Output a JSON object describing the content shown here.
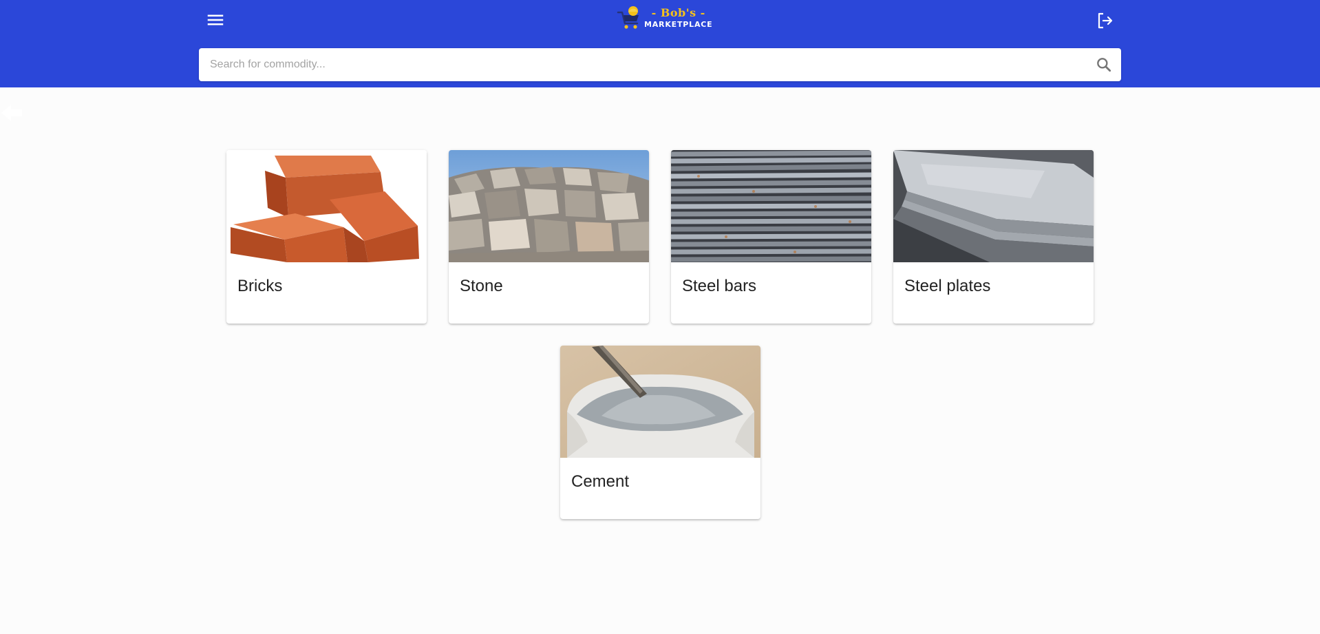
{
  "header": {
    "logo": {
      "line1": "- Bob's -",
      "line2": "MARKETPLACE"
    },
    "menu_icon": "menu-icon",
    "logout_icon": "logout-icon",
    "background_color": "#2b47d9"
  },
  "search": {
    "placeholder": "Search for commodity...",
    "value": "",
    "icon": "search-icon"
  },
  "nav": {
    "back_icon": "back-arrow-icon"
  },
  "commodities": [
    {
      "label": "Bricks",
      "image": "bricks-image"
    },
    {
      "label": "Stone",
      "image": "stone-image"
    },
    {
      "label": "Steel bars",
      "image": "steel-bars-image"
    },
    {
      "label": "Steel plates",
      "image": "steel-plates-image"
    },
    {
      "label": "Cement",
      "image": "cement-image"
    }
  ]
}
